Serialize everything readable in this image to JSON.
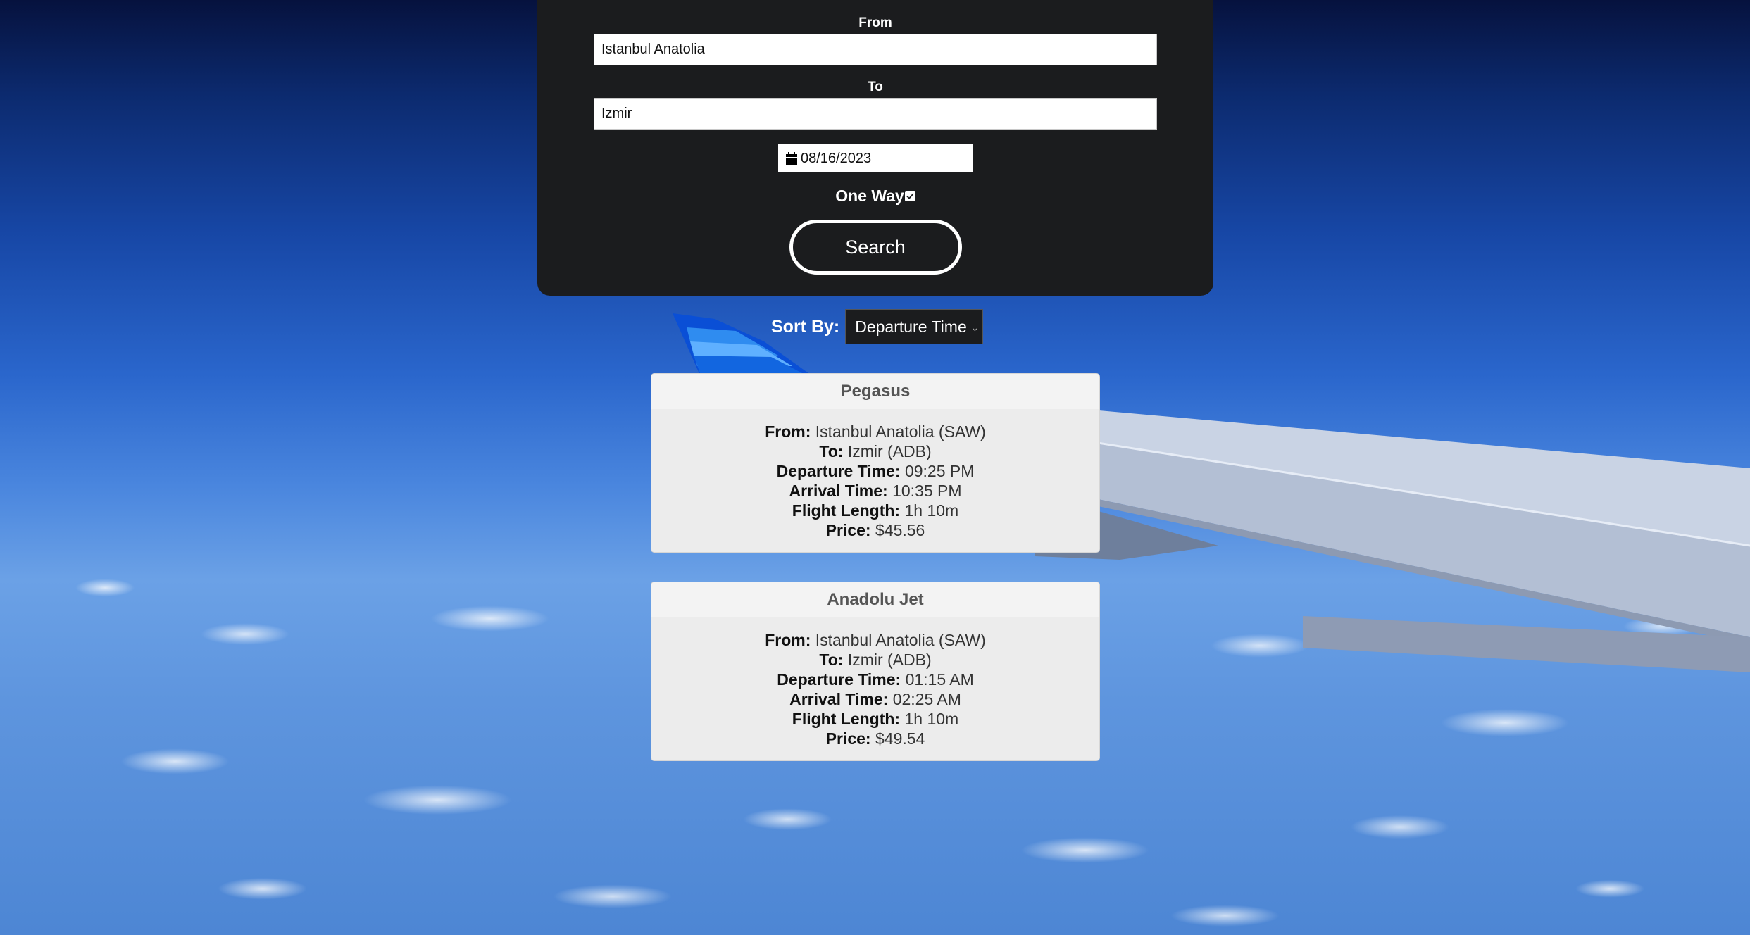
{
  "search": {
    "from_label": "From",
    "from_value": "Istanbul Anatolia",
    "to_label": "To",
    "to_value": "Izmir",
    "date_value": "08/16/2023",
    "one_way_label": "One Way",
    "one_way_checked": true,
    "search_button": "Search"
  },
  "sort": {
    "label": "Sort By:",
    "selected": "Departure Time"
  },
  "results": [
    {
      "airline": "Pegasus",
      "from_label": "From:",
      "from": "Istanbul Anatolia (SAW)",
      "to_label": "To:",
      "to": "Izmir (ADB)",
      "departure_label": "Departure Time:",
      "departure": "09:25 PM",
      "arrival_label": "Arrival Time:",
      "arrival": "10:35 PM",
      "length_label": "Flight Length:",
      "length": "1h 10m",
      "price_label": "Price:",
      "price": "$45.56"
    },
    {
      "airline": "Anadolu Jet",
      "from_label": "From:",
      "from": "Istanbul Anatolia (SAW)",
      "to_label": "To:",
      "to": "Izmir (ADB)",
      "departure_label": "Departure Time:",
      "departure": "01:15 AM",
      "arrival_label": "Arrival Time:",
      "arrival": "02:25 AM",
      "length_label": "Flight Length:",
      "length": "1h 10m",
      "price_label": "Price:",
      "price": "$49.54"
    }
  ],
  "icons": {
    "date": "calendar-icon",
    "one_way": "checkbox-checked-icon",
    "sort": "chevron-down-icon"
  }
}
